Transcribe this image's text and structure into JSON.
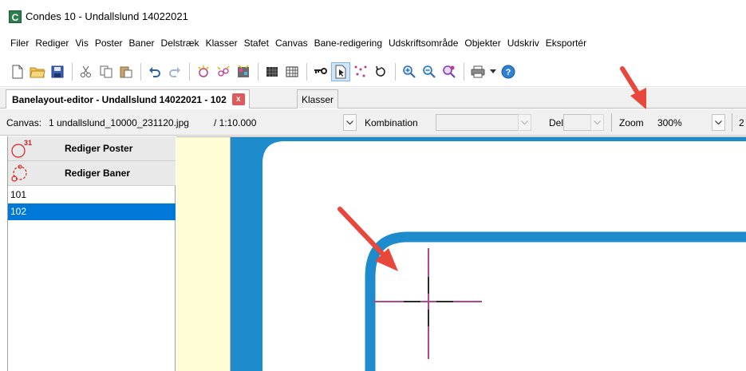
{
  "window": {
    "title": "Condes 10 - Undallslund 14022021",
    "app_icon_letter": "C"
  },
  "menu": [
    "Filer",
    "Rediger",
    "Vis",
    "Poster",
    "Baner",
    "Delstræk",
    "Klasser",
    "Stafet",
    "Canvas",
    "Bane-redigering",
    "Udskriftsområde",
    "Objekter",
    "Udskriv",
    "Eksportér"
  ],
  "toolbar": {
    "icons": [
      "new-file-icon",
      "open-folder-icon",
      "save-icon",
      "cut-icon",
      "copy-icon",
      "paste-icon",
      "undo-icon",
      "redo-icon",
      "control-add-icon",
      "control-edit-icon",
      "course-icon",
      "grid-dense-icon",
      "grid-icon",
      "key-icon",
      "pointer-tool-icon",
      "dots-icon",
      "loop-icon",
      "zoom-in-icon",
      "zoom-out-icon",
      "zoom-custom-icon",
      "print-icon",
      "help-icon"
    ]
  },
  "tabs": {
    "active": "Banelayout-editor - Undallslund 14022021 - 102",
    "close": "x",
    "second": "Klasser"
  },
  "options": {
    "canvas_label": "Canvas:",
    "canvas_value": "1 undallslund_10000_231120.jpg",
    "scale_value": "/ 1:10.000",
    "kombination_label": "Kombination",
    "del_label": "Del",
    "zoom_label": "Zoom",
    "zoom_value": "300%",
    "cut_off_label": "2"
  },
  "left_panel": {
    "edit_controls_label": "Rediger Poster",
    "edit_controls_badge": "31",
    "edit_courses_label": "Rediger Baner",
    "courses": [
      {
        "label": "101",
        "selected": false
      },
      {
        "label": "102",
        "selected": true
      }
    ]
  },
  "colors": {
    "course_blue": "#1e8bcd",
    "crosshair_magenta": "#b0468f",
    "selection_blue": "#0078d7",
    "map_margin_yellow": "#fffdd6",
    "arrow_red": "#e8473c"
  }
}
